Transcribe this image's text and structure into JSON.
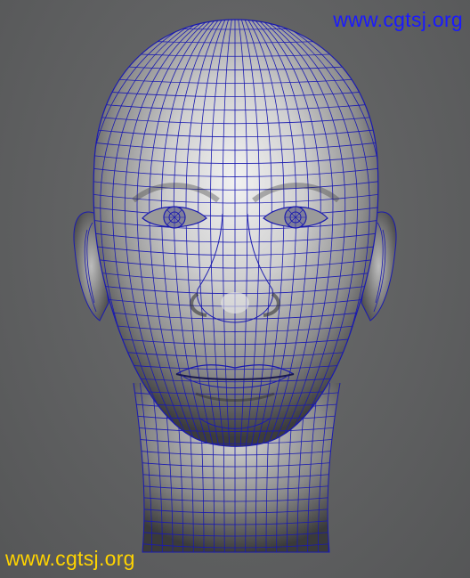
{
  "watermarks": {
    "top": "www.cgtsj.org",
    "bottom": "www.cgtsj.org"
  },
  "colors": {
    "background": "#5f6061",
    "wireframe": "#1a1ab0",
    "watermark_top": "#1a1aff",
    "watermark_bottom": "#ffd400"
  }
}
